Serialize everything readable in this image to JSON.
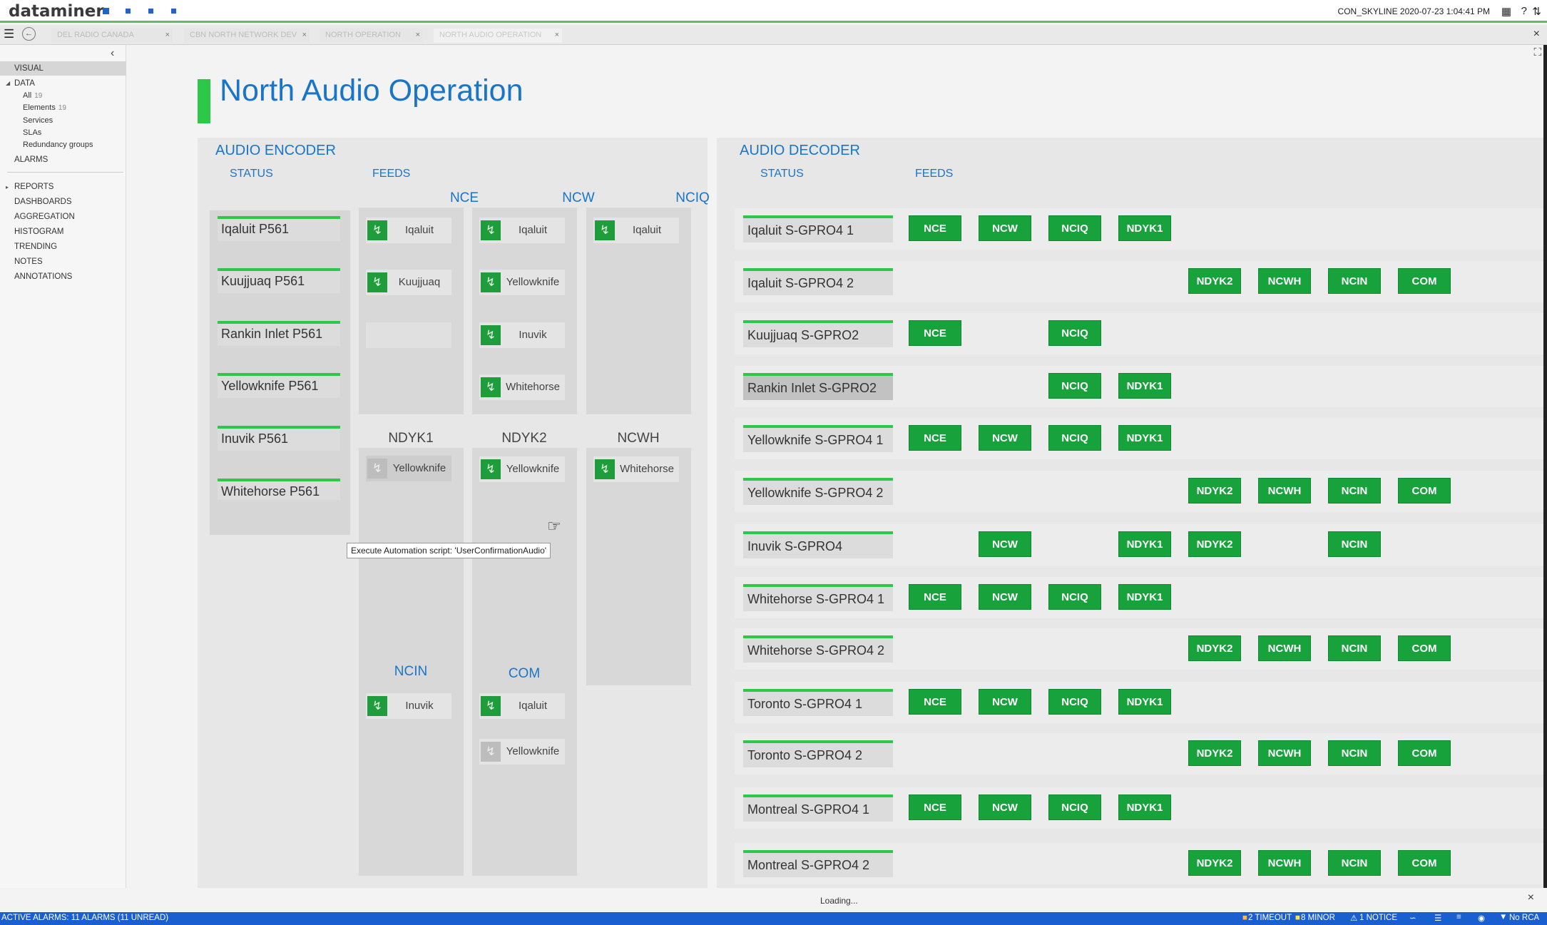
{
  "app": {
    "logo": "dataminer",
    "server_info": "CON_SKYLINE 2020-07-23 1:04:41 PM"
  },
  "tabs": [
    {
      "label": "DEL RADIO CANADA"
    },
    {
      "label": "CBN NORTH NETWORK DEV"
    },
    {
      "label": "NORTH OPERATION"
    },
    {
      "label": "NORTH AUDIO OPERATION"
    }
  ],
  "sidebar": {
    "visual": "VISUAL",
    "data": "DATA",
    "all": "All",
    "all_count": "19",
    "elements": "Elements",
    "elements_count": "19",
    "services": "Services",
    "slas": "SLAs",
    "redundancy": "Redundancy groups",
    "alarms": "ALARMS",
    "reports": "REPORTS",
    "dashboards": "DASHBOARDS",
    "aggregation": "AGGREGATION",
    "histogram": "HISTOGRAM",
    "trending": "TRENDING",
    "notes": "NOTES",
    "annotations": "ANNOTATIONS"
  },
  "page": {
    "title": "North Audio Operation"
  },
  "encoder": {
    "title": "AUDIO ENCODER",
    "status_label": "STATUS",
    "feeds_label": "FEEDS",
    "statuses": [
      "Iqaluit P561",
      "Kuujjuaq P561",
      "Rankin Inlet P561",
      "Yellowknife P561",
      "Inuvik P561",
      "Whitehorse P561"
    ],
    "columns": {
      "nce": {
        "title": "NCE",
        "feeds": [
          "Iqaluit",
          "Kuujjuaq"
        ]
      },
      "ncw": {
        "title": "NCW",
        "feeds": [
          "Iqaluit",
          "Yellowknife",
          "Inuvik",
          "Whitehorse"
        ]
      },
      "nciq": {
        "title": "NCIQ",
        "feeds": [
          "Iqaluit"
        ]
      },
      "ndyk1": {
        "title": "NDYK1",
        "feeds": [
          "Yellowknife"
        ]
      },
      "ndyk2": {
        "title": "NDYK2",
        "feeds": [
          "Yellowknife"
        ]
      },
      "ncwh": {
        "title": "NCWH",
        "feeds": [
          "Whitehorse"
        ]
      },
      "ncin": {
        "title": "NCIN",
        "feeds": [
          "Inuvik"
        ]
      },
      "com": {
        "title": "COM",
        "feeds": [
          "Iqaluit",
          "Yellowknife"
        ]
      }
    },
    "tooltip": "Execute Automation script: 'UserConfirmationAudio'"
  },
  "decoder": {
    "title": "AUDIO DECODER",
    "status_label": "STATUS",
    "feeds_label": "FEEDS",
    "rows": [
      {
        "name": "Iqaluit S-GPRO4 1",
        "btn": [
          "NCE",
          "NCW",
          "NCIQ",
          "NDYK1"
        ]
      },
      {
        "name": "Iqaluit S-GPRO4 2",
        "btn": [
          "NDYK2",
          "NCWH",
          "NCIN",
          "COM"
        ]
      },
      {
        "name": "Kuujjuaq S-GPRO2",
        "btn": [
          "NCE",
          "NCIQ"
        ]
      },
      {
        "name": "Rankin Inlet S-GPRO2",
        "btn": [
          "NCIQ",
          "NDYK1"
        ]
      },
      {
        "name": "Yellowknife S-GPRO4 1",
        "btn": [
          "NCE",
          "NCW",
          "NCIQ",
          "NDYK1"
        ]
      },
      {
        "name": "Yellowknife S-GPRO4 2",
        "btn": [
          "NDYK2",
          "NCWH",
          "NCIN",
          "COM"
        ]
      },
      {
        "name": "Inuvik S-GPRO4",
        "btn": [
          "NCW",
          "NDYK1",
          "NDYK2",
          "NCIN"
        ]
      },
      {
        "name": "Whitehorse S-GPRO4 1",
        "btn": [
          "NCE",
          "NCW",
          "NCIQ",
          "NDYK1"
        ]
      },
      {
        "name": "Whitehorse S-GPRO4 2",
        "btn": [
          "NDYK2",
          "NCWH",
          "NCIN",
          "COM"
        ]
      },
      {
        "name": "Toronto S-GPRO4 1",
        "btn": [
          "NCE",
          "NCW",
          "NCIQ",
          "NDYK1"
        ]
      },
      {
        "name": "Toronto S-GPRO4 2",
        "btn": [
          "NDYK2",
          "NCWH",
          "NCIN",
          "COM"
        ]
      },
      {
        "name": "Montreal S-GPRO4 1",
        "btn": [
          "NCE",
          "NCW",
          "NCIQ",
          "NDYK1"
        ]
      },
      {
        "name": "Montreal S-GPRO4 2",
        "btn": [
          "NDYK2",
          "NCWH",
          "NCIN",
          "COM"
        ]
      }
    ]
  },
  "status": {
    "loading": "Loading...",
    "alarms": "ACTIVE ALARMS: 11 ALARMS (11 UNREAD)",
    "timeout": "2 TIMEOUT",
    "minor": "8 MINOR",
    "notice": "1 NOTICE",
    "rca": "No RCA"
  },
  "colors": {
    "accent": "#1a75c8",
    "ok": "#17a23b",
    "status_bar": "#1a5fd0"
  }
}
